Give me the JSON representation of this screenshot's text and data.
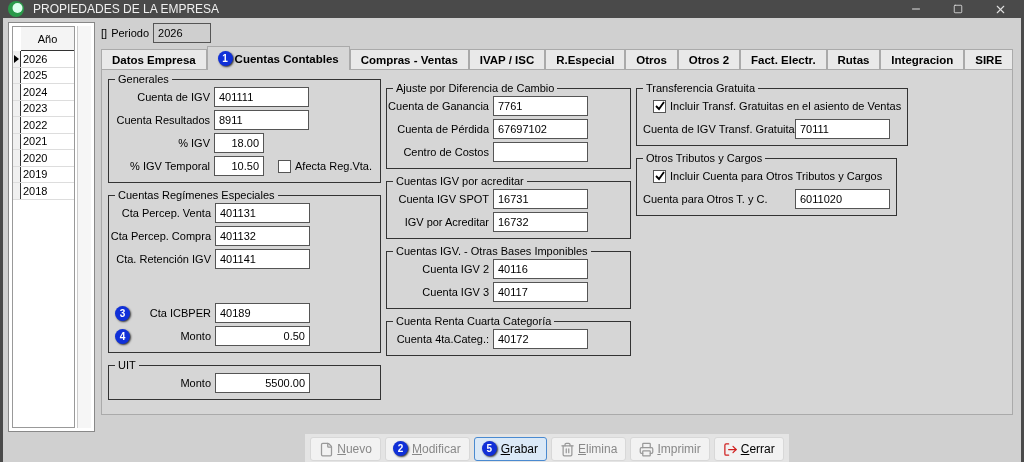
{
  "window": {
    "title": "PROPIEDADES DE LA EMPRESA"
  },
  "years": {
    "header": "Año",
    "rows": [
      {
        "label": "2026",
        "selected": true
      },
      {
        "label": "2025",
        "selected": false
      },
      {
        "label": "2024",
        "selected": false
      },
      {
        "label": "2023",
        "selected": false
      },
      {
        "label": "2022",
        "selected": false
      },
      {
        "label": "2021",
        "selected": false
      },
      {
        "label": "2020",
        "selected": false
      },
      {
        "label": "2019",
        "selected": false
      },
      {
        "label": "2018",
        "selected": false
      }
    ]
  },
  "periodo": {
    "marker": "[]",
    "label": "Periodo",
    "value": "2026"
  },
  "tabs": [
    {
      "label": "Datos Empresa",
      "selected": false
    },
    {
      "label": "Cuentas Contables",
      "selected": true,
      "badge": "1"
    },
    {
      "label": "Compras - Ventas",
      "selected": false
    },
    {
      "label": "IVAP / ISC",
      "selected": false
    },
    {
      "label": "R.Especial",
      "selected": false
    },
    {
      "label": "Otros",
      "selected": false
    },
    {
      "label": "Otros 2",
      "selected": false
    },
    {
      "label": "Fact. Electr.",
      "selected": false
    },
    {
      "label": "Rutas",
      "selected": false
    },
    {
      "label": "Integracion",
      "selected": false
    },
    {
      "label": "SIRE",
      "selected": false
    }
  ],
  "columns": [
    [
      {
        "title": "Generales",
        "rows": [
          {
            "label": "Cuenta de IGV",
            "value": "401111",
            "kind": "account"
          },
          {
            "label": "Cuenta Resultados",
            "value": "8911",
            "kind": "account"
          },
          {
            "label": "% IGV",
            "value": "18.00",
            "kind": "percent"
          },
          {
            "label": "% IGV Temporal",
            "value": "10.50",
            "kind": "percent",
            "checkbox": {
              "label": "Afecta Reg.Vta.",
              "checked": false
            }
          }
        ]
      },
      {
        "title": "Cuentas Regímenes Especiales",
        "rows": [
          {
            "label": "Cta Percep. Venta",
            "value": "401131",
            "kind": "account"
          },
          {
            "label": "Cta Percep. Compra",
            "value": "401132",
            "kind": "account"
          },
          {
            "label": "Cta. Retención IGV",
            "value": "401141",
            "kind": "account"
          }
        ],
        "extra_rows": [
          {
            "label": "Cta ICBPER",
            "value": "40189",
            "kind": "account",
            "badge": "3"
          },
          {
            "label": "Monto",
            "value": "0.50",
            "kind": "amount",
            "badge": "4"
          }
        ]
      },
      {
        "title": "UIT",
        "rows": [
          {
            "label": "Monto",
            "value": "5500.00",
            "kind": "amount"
          }
        ]
      }
    ],
    [
      {
        "title": "Ajuste por Diferencia de Cambio",
        "rows": [
          {
            "label": "Cuenta de Ganancia",
            "value": "7761",
            "kind": "account"
          },
          {
            "label": "Cuenta de Pérdida",
            "value": "67697102",
            "kind": "account"
          },
          {
            "label": "Centro de Costos",
            "kind": "account"
          }
        ]
      },
      {
        "title": "Cuentas IGV por acreditar",
        "rows": [
          {
            "label": "Cuenta IGV SPOT",
            "value": "16731",
            "kind": "account"
          },
          {
            "label": "IGV por Acreditar",
            "value": "16732",
            "kind": "account"
          }
        ]
      },
      {
        "title": "Cuentas IGV. - Otras Bases Imponibles",
        "rows": [
          {
            "label": "Cuenta IGV 2",
            "value": "40116",
            "kind": "account"
          },
          {
            "label": "Cuenta IGV 3",
            "value": "40117",
            "kind": "account"
          }
        ]
      },
      {
        "title": "Cuenta Renta Cuarta Categoría",
        "rows": [
          {
            "label": "Cuenta 4ta.Categ.:",
            "value": "40172",
            "kind": "account"
          }
        ]
      }
    ],
    [
      {
        "title": "Transferencia Gratuita",
        "check": {
          "label": "Incluir Transf. Gratuitas en el asiento de Ventas",
          "checked": true
        },
        "rows": [
          {
            "label": "Cuenta de IGV Transf. Gratuita",
            "value": "70111",
            "kind": "account"
          }
        ]
      },
      {
        "title": "Otros Tributos y Cargos",
        "check": {
          "label": "Incluir Cuenta para Otros Tributos y Cargos",
          "checked": true
        },
        "rows": [
          {
            "label": "Cuenta para Otros T. y C.",
            "value": "6011020",
            "kind": "account"
          }
        ]
      }
    ]
  ],
  "buttons": [
    {
      "label": "Nuevo",
      "kind": "new",
      "disabled": true,
      "focused": false
    },
    {
      "label": "Modificar",
      "kind": "edit",
      "disabled": true,
      "focused": false,
      "badge": "2"
    },
    {
      "label": "Grabar",
      "kind": "save",
      "disabled": false,
      "focused": true,
      "badge": "5"
    },
    {
      "label": "Elimina",
      "kind": "delete",
      "disabled": true,
      "focused": false
    },
    {
      "label": "Imprimir",
      "kind": "print",
      "disabled": true,
      "focused": false
    },
    {
      "label": "Cerrar",
      "kind": "exit",
      "disabled": false,
      "focused": false
    }
  ]
}
